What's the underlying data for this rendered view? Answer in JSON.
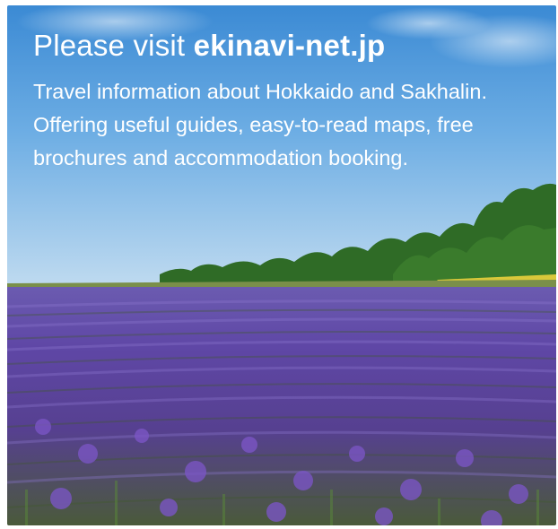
{
  "banner": {
    "headline_prefix": "Please visit ",
    "headline_domain": "ekinavi-net.jp",
    "description": "Travel information about Hokkaido and Sakhalin. Offering useful guides, easy-to-read maps, free brochures and accommodation booking.",
    "image_subject": "lavender field under blue sky",
    "colors": {
      "sky_top": "#3f8fd6",
      "sky_bottom": "#b4d4ee",
      "lavender": "#6a4aa8",
      "grass": "#4f7a2c",
      "trees": "#2e6a24",
      "text": "#ffffff"
    }
  }
}
